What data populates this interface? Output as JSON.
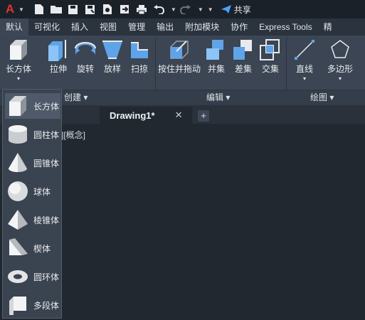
{
  "quick_access": {
    "share_label": "共享"
  },
  "ribbon_tabs": [
    "默认",
    "可视化",
    "插入",
    "视图",
    "管理",
    "输出",
    "附加模块",
    "协作",
    "Express Tools",
    "精"
  ],
  "ribbon": {
    "buttons": {
      "box": "长方体",
      "extrude": "拉伸",
      "revolve": "旋转",
      "loft": "放样",
      "sweep": "扫掠",
      "presspull": "按住并拖动",
      "union": "并集",
      "subtract": "差集",
      "intersect": "交集",
      "line": "直线",
      "polygon": "多边形"
    },
    "panels": {
      "create": "创建 ▾",
      "edit": "编辑 ▾",
      "draw": "绘图 ▾"
    }
  },
  "document_tab": {
    "title": "Drawing1*",
    "close": "✕",
    "new": "+"
  },
  "viewport_label": "][概念]",
  "solid_dropdown": {
    "items": [
      "长方体",
      "圆柱体",
      "圆锥体",
      "球体",
      "棱锥体",
      "楔体",
      "圆环体",
      "多段体"
    ],
    "selected": "长方体"
  }
}
